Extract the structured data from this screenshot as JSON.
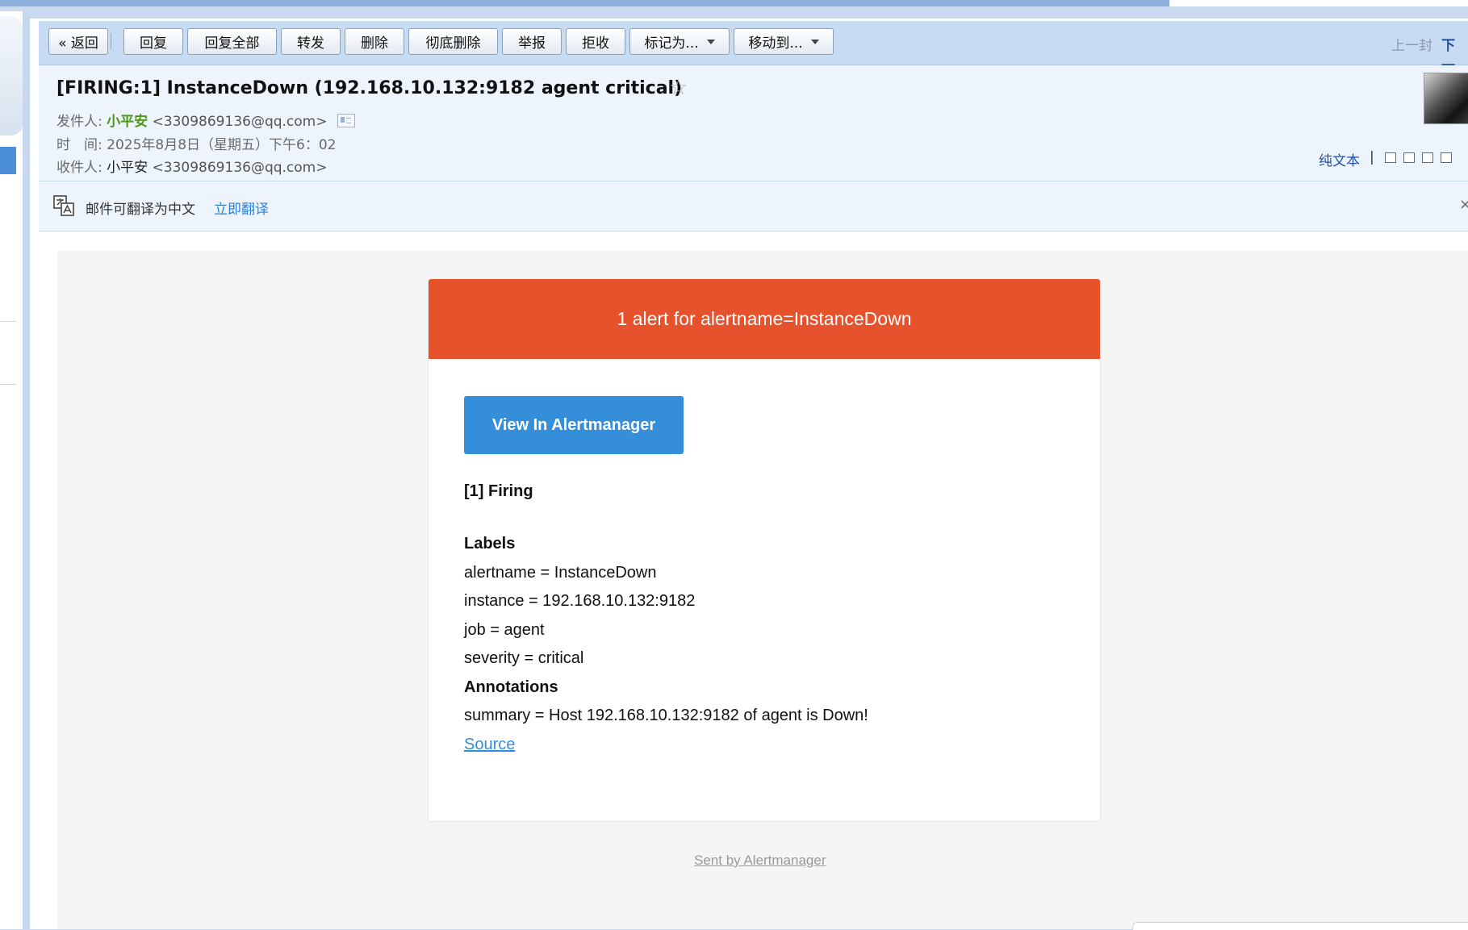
{
  "toolbar": {
    "back": "« 返回",
    "reply": "回复",
    "reply_all": "回复全部",
    "forward": "转发",
    "delete": "删除",
    "delete_forever": "彻底删除",
    "report": "举报",
    "reject": "拒收",
    "mark_as": "标记为...",
    "move_to": "移动到...",
    "prev_mail": "上一封",
    "next_mail": "下一"
  },
  "email": {
    "subject": "[FIRING:1] InstanceDown (192.168.10.132:9182 agent critical)",
    "from_label": "发件人:",
    "from_name": "小平安",
    "from_addr": "<3309869136@qq.com>",
    "time_label": "时　间:",
    "time_value": "2025年8月8日（星期五）下午6：02",
    "to_label": "收件人:",
    "to_name": "小平安",
    "to_addr": "<3309869136@qq.com>",
    "plain_text": "纯文本",
    "divider": "|"
  },
  "translate": {
    "message": "邮件可翻译为中文",
    "action": "立即翻译",
    "close": "×"
  },
  "alert": {
    "header": "1 alert for alertname=InstanceDown",
    "button": "View In Alertmanager",
    "firing": "[1] Firing",
    "labels_heading": "Labels",
    "labels": [
      "alertname = InstanceDown",
      "instance = 192.168.10.132:9182",
      "job = agent",
      "severity = critical"
    ],
    "annotations_heading": "Annotations",
    "annotations": [
      "summary = Host 192.168.10.132:9182 of agent is Down!"
    ],
    "source": "Source",
    "footer": "Sent by Alertmanager"
  },
  "colors": {
    "alert_red": "#e6522c",
    "button_blue": "#348eda",
    "toolbar_bg": "#c7dbf3",
    "header_bg": "#eef4fc",
    "sender_green": "#4d9a1a",
    "link_blue": "#1f4f9e"
  },
  "icons": [
    "star-icon",
    "vcard-icon",
    "translate-icon",
    "new-window-icon",
    "page-icon",
    "download-icon",
    "print-icon"
  ]
}
